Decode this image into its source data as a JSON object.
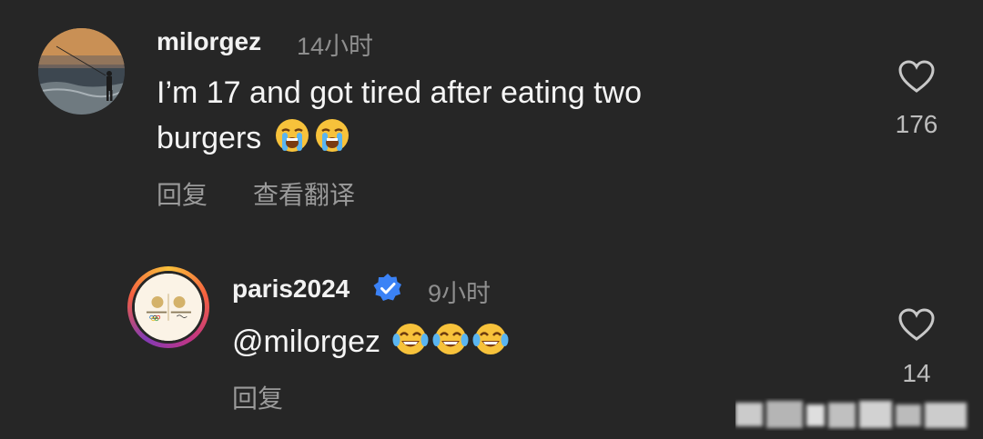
{
  "comments": [
    {
      "username": "milorgez",
      "time": "14小时",
      "text_line1": "I’m 17 and got tired after eating two",
      "text_line2": "burgers",
      "emojis": [
        "crying-face",
        "crying-face"
      ],
      "actions": {
        "reply": "回复",
        "translate": "查看翻译"
      },
      "likes": "176",
      "avatar": "beach-fisherman-sunset"
    },
    {
      "username": "paris2024",
      "verified": true,
      "time": "9小时",
      "text": "@milorgez",
      "emojis": [
        "tears-of-joy",
        "tears-of-joy",
        "tears-of-joy"
      ],
      "actions": {
        "reply": "回复"
      },
      "likes": "14",
      "avatar": "paris-2024-logo"
    }
  ],
  "colors": {
    "background": "#262626",
    "text": "#f5f5f5",
    "muted": "#8e8e8e",
    "verified": "#3b82f6"
  }
}
